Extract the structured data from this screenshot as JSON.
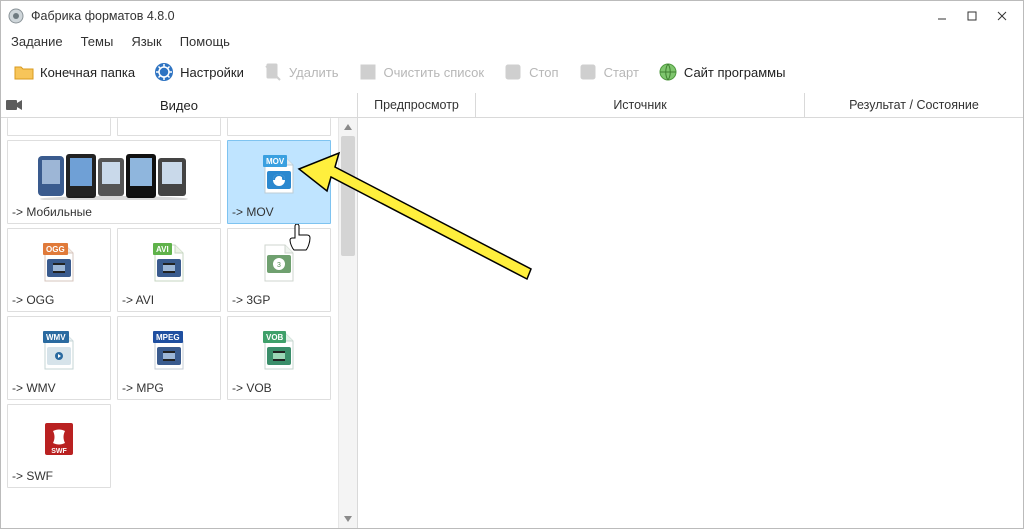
{
  "window": {
    "title": "Фабрика форматов 4.8.0"
  },
  "menu": {
    "task": "Задание",
    "themes": "Темы",
    "lang": "Язык",
    "help": "Помощь"
  },
  "toolbar": {
    "output_folder": "Конечная папка",
    "settings": "Настройки",
    "delete": "Удалить",
    "clear_list": "Очистить список",
    "stop": "Стоп",
    "start": "Старт",
    "website": "Сайт программы"
  },
  "left_panel": {
    "title": "Видео",
    "tiles": {
      "mobile": "->  Мобильные",
      "mov": "->  MOV",
      "ogg": "->  OGG",
      "avi": "->  AVI",
      "3gp": "->  3GP",
      "wmv": "->  WMV",
      "mpg": "->  MPG",
      "vob": "->  VOB",
      "swf": "->  SWF"
    }
  },
  "columns": {
    "preview": "Предпросмотр",
    "source": "Источник",
    "result": "Результат / Состояние"
  }
}
